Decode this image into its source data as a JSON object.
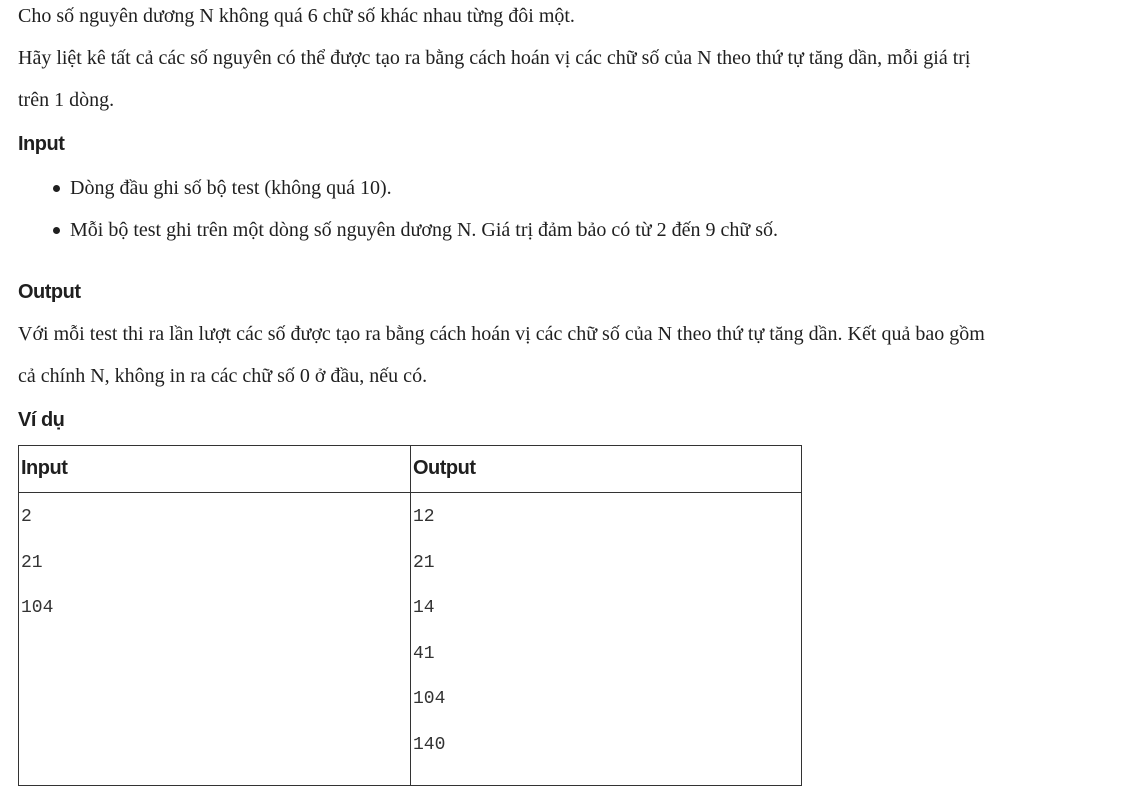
{
  "statement": {
    "intro": "Cho số nguyên dương N không quá 6 chữ số khác nhau từng đôi một.",
    "desc_line1": "Hãy liệt kê tất cả các số nguyên có thể được tạo ra bằng cách hoán vị các chữ số của N theo thứ tự tăng dần, mỗi giá trị",
    "desc_line2": "trên 1 dòng."
  },
  "input_section": {
    "heading": "Input",
    "bullets": [
      "Dòng đầu ghi số bộ test (không quá 10).",
      "Mỗi bộ test ghi trên một dòng số nguyên dương N. Giá trị đảm bảo có từ 2 đến 9 chữ số."
    ]
  },
  "output_section": {
    "heading": "Output",
    "line1": "Với mỗi test thi ra lần lượt các số được tạo ra bằng cách hoán vị các chữ số của N theo thứ tự tăng dần. Kết quả bao gồm",
    "line2": "cả chính N, không in ra các chữ số 0 ở đầu, nếu có."
  },
  "example": {
    "heading": "Ví dụ",
    "columns": [
      "Input",
      "Output"
    ],
    "input_lines": [
      "2",
      "21",
      "104"
    ],
    "output_lines": [
      "12",
      "21",
      "14",
      "41",
      "104",
      "140"
    ]
  }
}
